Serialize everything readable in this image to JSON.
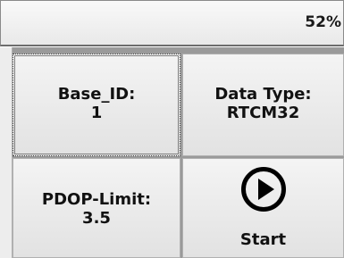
{
  "status_bar": {
    "battery": "52%"
  },
  "tiles": {
    "base_id": {
      "label": "Base_ID:",
      "value": "1"
    },
    "data_type": {
      "label": "Data Type:",
      "value": "RTCM32"
    },
    "pdop_limit": {
      "label": "PDOP-Limit:",
      "value": "3.5"
    },
    "start": {
      "label": "Start",
      "icon": "play-circle-icon"
    }
  }
}
